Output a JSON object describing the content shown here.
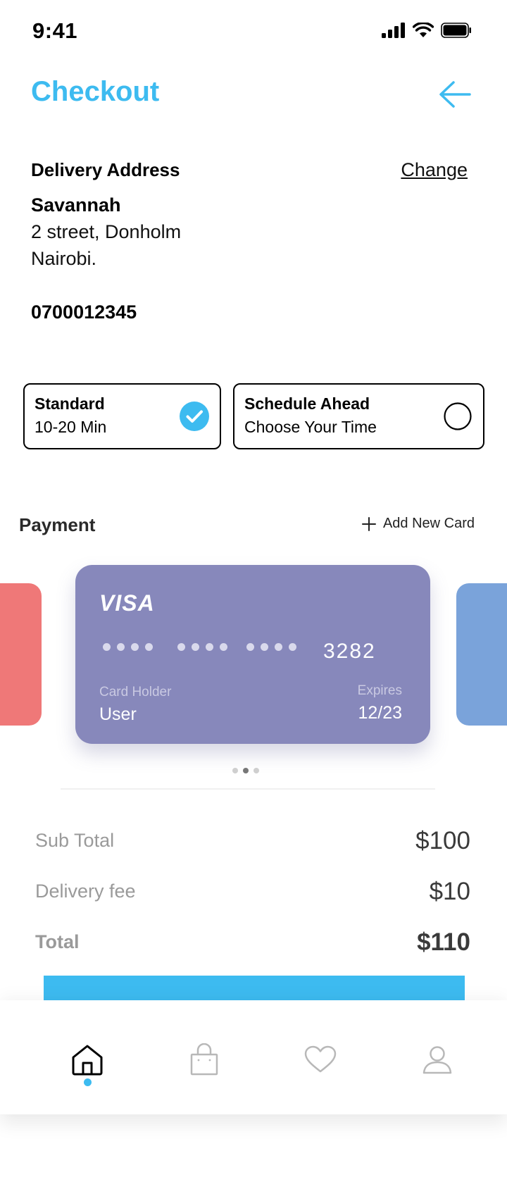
{
  "status_bar": {
    "time": "9:41"
  },
  "header": {
    "title": "Checkout"
  },
  "address": {
    "heading": "Delivery Address",
    "change_label": "Change",
    "name": "Savannah",
    "line1": "2 street, Donholm",
    "line2": "Nairobi.",
    "phone": "0700012345"
  },
  "delivery_options": [
    {
      "title": "Standard",
      "subtitle": "10-20 Min",
      "selected": true
    },
    {
      "title": "Schedule Ahead",
      "subtitle": "Choose Your Time",
      "selected": false
    }
  ],
  "payment": {
    "heading": "Payment",
    "add_card_label": "Add New Card",
    "card": {
      "brand": "VISA",
      "last_digits": "3282",
      "holder_label": "Card Holder",
      "holder": "User",
      "expires_label": "Expires",
      "expires": "12/23",
      "color": "#8788BB"
    },
    "side_card_colors": [
      "#EF7878",
      "#7AA3DA"
    ],
    "pager": {
      "count": 3,
      "active_index": 1
    }
  },
  "summary": {
    "subtotal_label": "Sub Total",
    "subtotal_value": "$100",
    "delivery_label": "Delivery fee",
    "delivery_value": "$10",
    "total_label": "Total",
    "total_value": "$110"
  },
  "theme": {
    "accent": "#3DBBF0"
  },
  "bottom_nav": {
    "items": [
      {
        "icon": "home-icon",
        "active": true
      },
      {
        "icon": "shopping-bag-icon",
        "active": false
      },
      {
        "icon": "heart-icon",
        "active": false
      },
      {
        "icon": "profile-icon",
        "active": false
      }
    ]
  }
}
